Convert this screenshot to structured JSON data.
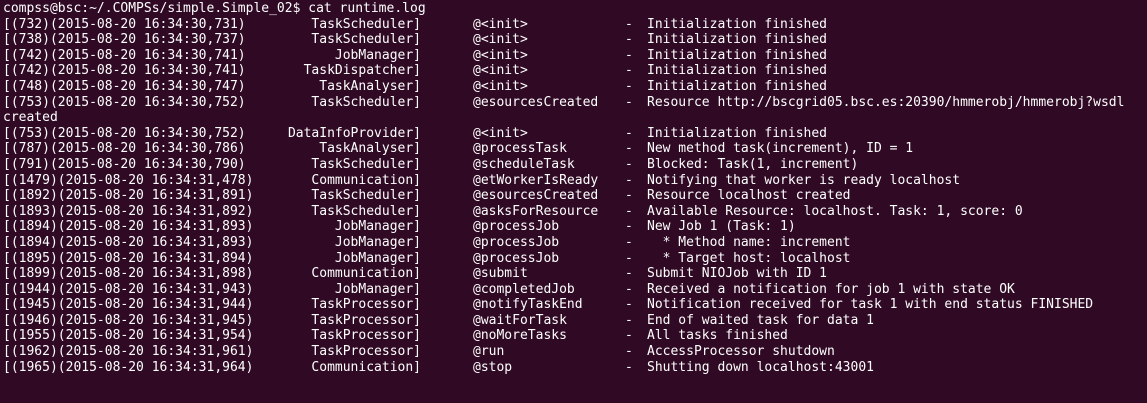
{
  "terminal": {
    "prompt": "compss@bsc:~/.COMPSs/simple.Simple_02$ cat runtime.log",
    "rows": [
      {
        "kind": "entry",
        "id": "[(732)(2015-08-20 16:34:30,731)",
        "component": "TaskScheduler]",
        "method": "@<init>",
        "dash": "-",
        "message": "Initialization finished"
      },
      {
        "kind": "entry",
        "id": "[(738)(2015-08-20 16:34:30,737)",
        "component": "TaskScheduler]",
        "method": "@<init>",
        "dash": "-",
        "message": "Initialization finished"
      },
      {
        "kind": "entry",
        "id": "[(742)(2015-08-20 16:34:30,741)",
        "component": "JobManager]",
        "method": "@<init>",
        "dash": "-",
        "message": "Initialization finished"
      },
      {
        "kind": "entry",
        "id": "[(742)(2015-08-20 16:34:30,741)",
        "component": "TaskDispatcher]",
        "method": "@<init>",
        "dash": "-",
        "message": "Initialization finished"
      },
      {
        "kind": "entry",
        "id": "[(748)(2015-08-20 16:34:30,747)",
        "component": "TaskAnalyser]",
        "method": "@<init>",
        "dash": "-",
        "message": "Initialization finished"
      },
      {
        "kind": "entry",
        "id": "[(753)(2015-08-20 16:34:30,752)",
        "component": "TaskScheduler]",
        "method": "@esourcesCreated",
        "dash": "-",
        "message": "Resource http://bscgrid05.bsc.es:20390/hmmerobj/hmmerobj?wsdl"
      },
      {
        "kind": "wrap",
        "text": "created"
      },
      {
        "kind": "entry",
        "id": "[(753)(2015-08-20 16:34:30,752)",
        "component": "DataInfoProvider]",
        "method": "@<init>",
        "dash": "-",
        "message": "Initialization finished"
      },
      {
        "kind": "entry",
        "id": "[(787)(2015-08-20 16:34:30,786)",
        "component": "TaskAnalyser]",
        "method": "@processTask",
        "dash": "-",
        "message": "New method task(increment), ID = 1"
      },
      {
        "kind": "entry",
        "id": "[(791)(2015-08-20 16:34:30,790)",
        "component": "TaskScheduler]",
        "method": "@scheduleTask",
        "dash": "-",
        "message": "Blocked: Task(1, increment)"
      },
      {
        "kind": "entry",
        "id": "[(1479)(2015-08-20 16:34:31,478)",
        "component": "Communication]",
        "method": "@etWorkerIsReady",
        "dash": "-",
        "message": "Notifying that worker is ready localhost"
      },
      {
        "kind": "entry",
        "id": "[(1892)(2015-08-20 16:34:31,891)",
        "component": "TaskScheduler]",
        "method": "@esourcesCreated",
        "dash": "-",
        "message": "Resource localhost created"
      },
      {
        "kind": "entry",
        "id": "[(1893)(2015-08-20 16:34:31,892)",
        "component": "TaskScheduler]",
        "method": "@asksForResource",
        "dash": "-",
        "message": "Available Resource: localhost. Task: 1, score: 0"
      },
      {
        "kind": "entry",
        "id": "[(1894)(2015-08-20 16:34:31,893)",
        "component": "JobManager]",
        "method": "@processJob",
        "dash": "-",
        "message": "New Job 1 (Task: 1)"
      },
      {
        "kind": "entry",
        "id": "[(1894)(2015-08-20 16:34:31,893)",
        "component": "JobManager]",
        "method": "@processJob",
        "dash": "-",
        "message": "  * Method name: increment"
      },
      {
        "kind": "entry",
        "id": "[(1895)(2015-08-20 16:34:31,894)",
        "component": "JobManager]",
        "method": "@processJob",
        "dash": "-",
        "message": "  * Target host: localhost"
      },
      {
        "kind": "entry",
        "id": "[(1899)(2015-08-20 16:34:31,898)",
        "component": "Communication]",
        "method": "@submit",
        "dash": "-",
        "message": "Submit NIOJob with ID 1"
      },
      {
        "kind": "entry",
        "id": "[(1944)(2015-08-20 16:34:31,943)",
        "component": "JobManager]",
        "method": "@completedJob",
        "dash": "-",
        "message": "Received a notification for job 1 with state OK"
      },
      {
        "kind": "entry",
        "id": "[(1945)(2015-08-20 16:34:31,944)",
        "component": "TaskProcessor]",
        "method": "@notifyTaskEnd",
        "dash": "-",
        "message": "Notification received for task 1 with end status FINISHED"
      },
      {
        "kind": "entry",
        "id": "[(1946)(2015-08-20 16:34:31,945)",
        "component": "TaskProcessor]",
        "method": "@waitForTask",
        "dash": "-",
        "message": "End of waited task for data 1"
      },
      {
        "kind": "entry",
        "id": "[(1955)(2015-08-20 16:34:31,954)",
        "component": "TaskProcessor]",
        "method": "@noMoreTasks",
        "dash": "-",
        "message": "All tasks finished"
      },
      {
        "kind": "entry",
        "id": "[(1962)(2015-08-20 16:34:31,961)",
        "component": "TaskProcessor]",
        "method": "@run",
        "dash": "-",
        "message": "AccessProcessor shutdown"
      },
      {
        "kind": "entry",
        "id": "[(1965)(2015-08-20 16:34:31,964)",
        "component": "Communication]",
        "method": "@stop",
        "dash": "-",
        "message": "Shutting down localhost:43001"
      }
    ]
  },
  "colors": {
    "background": "#300a24",
    "text": "#ffffff"
  }
}
